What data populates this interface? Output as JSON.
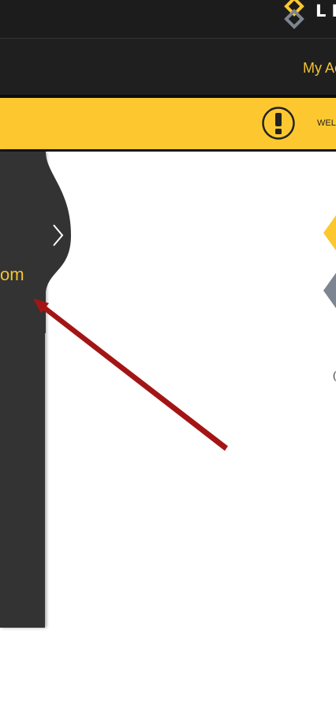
{
  "header": {
    "logo_text": "LI"
  },
  "nav": {
    "account_label": "My Ac"
  },
  "alert": {
    "message": "WEL"
  },
  "sidebar": {
    "label": "om"
  },
  "content": {
    "side_letter": "("
  },
  "colors": {
    "top_bar": "#1c1c1c",
    "nav_bar": "#1f1f1f",
    "accent_yellow": "#fdc82f",
    "nav_text": "#f3c431",
    "sidebar": "#333333",
    "arrow": "#a31515",
    "logo_gray": "#7d8590"
  },
  "icons": {
    "logo": "diamond-logo-icon",
    "alert": "exclamation-circle-icon",
    "sidebar_toggle": "chevron-right-icon",
    "annotation": "arrow-annotation"
  }
}
